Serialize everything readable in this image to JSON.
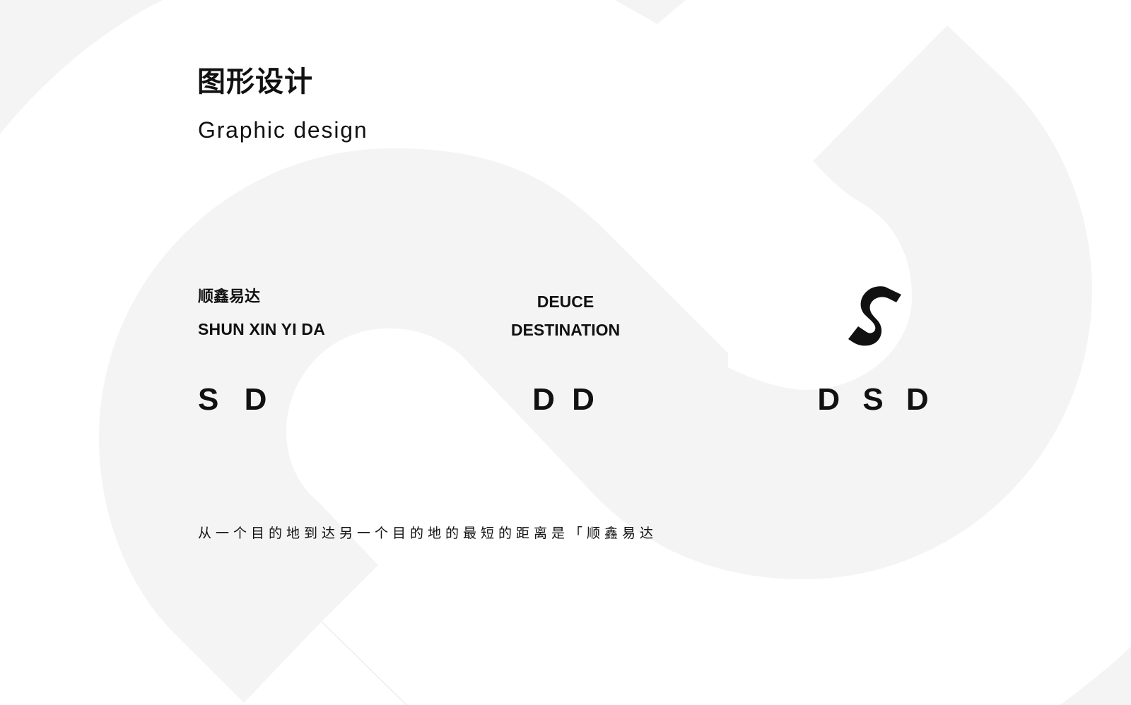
{
  "heading": {
    "title_cn": "图形设计",
    "title_en": "Graphic design"
  },
  "columns": [
    {
      "brand_cn": "顺鑫易达",
      "brand_en": "SHUN XIN YI DA",
      "abbreviation": "S D"
    },
    {
      "line1": "DEUCE",
      "line2": "DESTINATION",
      "abbreviation": "D D"
    },
    {
      "logo": "s-logo-icon",
      "abbreviation": "D S D"
    }
  ],
  "slogan": "从一个目的地到达另一个目的地的最短的距离是「顺鑫易达",
  "colors": {
    "background": "#ffffff",
    "shape": "#f4f4f4",
    "text": "#111111"
  }
}
